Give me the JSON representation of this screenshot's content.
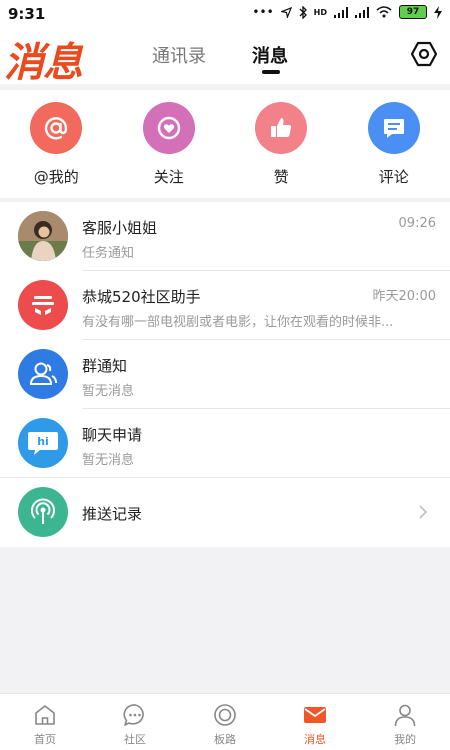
{
  "status_bar": {
    "time": "9:31",
    "dots": "•••",
    "network": "HD",
    "battery": "97"
  },
  "header": {
    "logo_text": "消息",
    "tabs": [
      {
        "label": "通讯录",
        "active": false
      },
      {
        "label": "消息",
        "active": true
      }
    ],
    "settings_icon": "hexagon-settings-icon"
  },
  "quick_actions": [
    {
      "label": "@我的",
      "icon": "at-icon",
      "color": "#f26a5d"
    },
    {
      "label": "关注",
      "icon": "heart-icon",
      "color": "#d470b8"
    },
    {
      "label": "赞",
      "icon": "thumbs-up-icon",
      "color": "#f28189"
    },
    {
      "label": "评论",
      "icon": "comment-icon",
      "color": "#4b8ff4"
    }
  ],
  "messages": [
    {
      "title": "客服小姐姐",
      "subtitle": "任务通知",
      "time": "09:26",
      "avatar": "photo-avatar"
    },
    {
      "title": "恭城520社区助手",
      "subtitle": "有没有哪一部电视剧或者电影，让你在观看的时候非...",
      "time": "昨天20:00",
      "avatar": "app-logo-avatar",
      "color": "#ec4c4c"
    },
    {
      "title": "群通知",
      "subtitle": "暂无消息",
      "time": "",
      "avatar": "group-icon",
      "color": "#2e7be4"
    },
    {
      "title": "聊天申请",
      "subtitle": "暂无消息",
      "time": "",
      "avatar": "hi-chat-icon",
      "color": "#2f9ae8"
    }
  ],
  "push_record": {
    "title": "推送记录",
    "avatar": "broadcast-icon",
    "color": "#3cb691"
  },
  "bottom_nav": [
    {
      "label": "首页",
      "icon": "home-icon",
      "active": false
    },
    {
      "label": "社区",
      "icon": "chat-bubble-icon",
      "active": false
    },
    {
      "label": "板路",
      "icon": "circle-icon",
      "active": false
    },
    {
      "label": "消息",
      "icon": "mail-icon",
      "active": true
    },
    {
      "label": "我的",
      "icon": "person-icon",
      "active": false
    }
  ],
  "colors": {
    "accent": "#f0562a",
    "logo": "#ea4a1e"
  }
}
